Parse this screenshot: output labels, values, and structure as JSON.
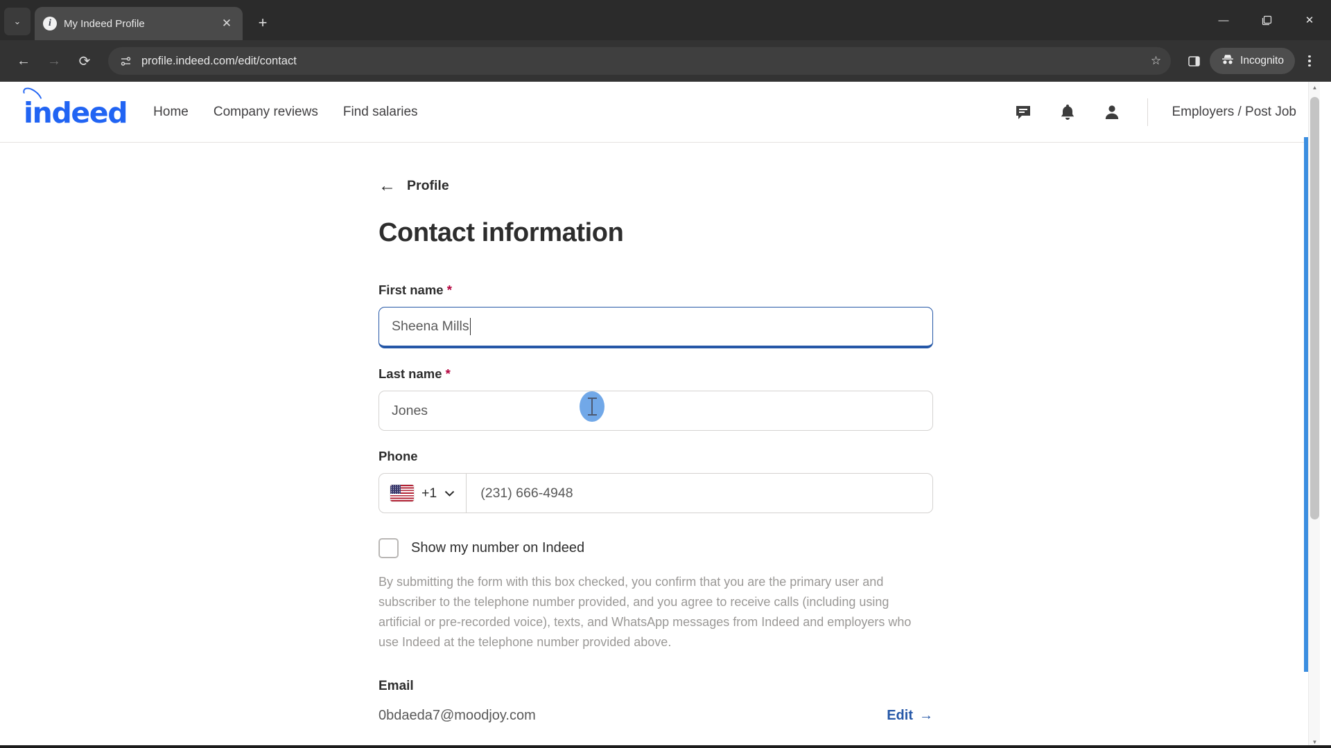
{
  "browser": {
    "tab": {
      "title": "My Indeed Profile",
      "favicon": "info-circle-icon",
      "close": "✕"
    },
    "new_tab": "+",
    "tab_list": "⌄",
    "window": {
      "minimize": "—",
      "maximize": "❐",
      "close": "✕"
    },
    "nav": {
      "back": "←",
      "forward": "→",
      "reload": "⟳"
    },
    "url": "profile.indeed.com/edit/contact",
    "star": "☆",
    "side_panel": "side-panel-icon",
    "incognito_label": "Incognito",
    "menu": "three-dot-menu"
  },
  "site_header": {
    "logo_text": "indeed",
    "nav_items": [
      {
        "label": "Home"
      },
      {
        "label": "Company reviews"
      },
      {
        "label": "Find salaries"
      }
    ],
    "icons": [
      {
        "name": "messages-icon"
      },
      {
        "name": "notifications-bell-icon"
      },
      {
        "name": "account-person-icon"
      }
    ],
    "employers_link": "Employers / Post Job"
  },
  "page": {
    "back_label": "Profile",
    "back_arrow": "←",
    "title": "Contact information",
    "required_mark": "*",
    "fields": {
      "first_name": {
        "label": "First name",
        "value": "Sheena Mills",
        "required": true,
        "focused": true
      },
      "last_name": {
        "label": "Last name",
        "value": "Jones",
        "required": true,
        "focused": false
      },
      "phone": {
        "label": "Phone",
        "country_flag": "us-flag-icon",
        "country_code": "+1",
        "chevron": "⌄",
        "value": "(231) 666-4948"
      }
    },
    "checkbox": {
      "label": "Show my number on Indeed",
      "checked": false
    },
    "disclaimer": "By submitting the form with this box checked, you confirm that you are the primary user and subscriber to the telephone number provided, and you agree to receive calls (including using artificial or pre-recorded voice), texts, and WhatsApp messages from Indeed and employers who use Indeed at the telephone number provided above.",
    "email": {
      "label": "Email",
      "value": "0bdaeda7@moodjoy.com",
      "edit_label": "Edit",
      "edit_arrow": "→"
    }
  },
  "colors": {
    "indeed_blue": "#2164f3",
    "link_blue": "#2557a7",
    "required_red": "#b3003c",
    "cursor_blue": "#4a90e2"
  },
  "scrollbar": {
    "up": "▲",
    "down": "▼"
  }
}
